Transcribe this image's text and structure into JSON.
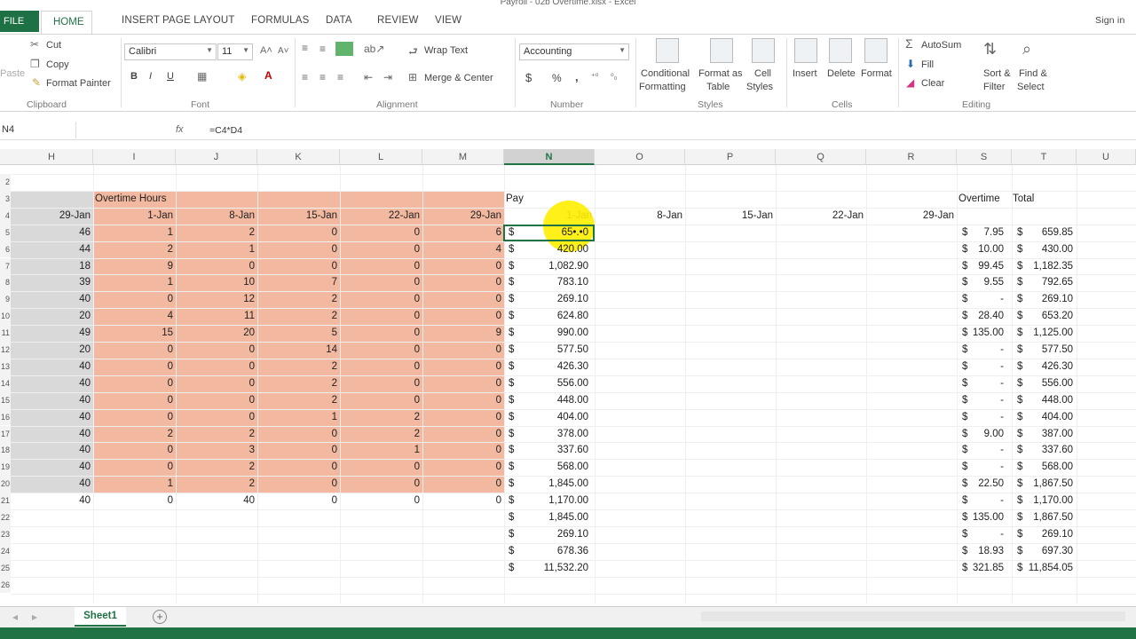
{
  "window": {
    "title": "Payroll - 02b Overtime.xlsx - Excel",
    "sign_in": "Sign in"
  },
  "tabs": {
    "file": "FILE",
    "home": "HOME",
    "insert": "INSERT",
    "page_layout": "PAGE LAYOUT",
    "formulas": "FORMULAS",
    "data": "DATA",
    "review": "REVIEW",
    "view": "VIEW"
  },
  "ribbon": {
    "clipboard": {
      "cut": "Cut",
      "copy": "Copy",
      "format_painter": "Format Painter",
      "paste": "Paste",
      "group": "Clipboard"
    },
    "font": {
      "name": "Calibri",
      "size": "11",
      "bold": "B",
      "italic": "I",
      "underline": "U",
      "group": "Font"
    },
    "alignment": {
      "wrap": "Wrap Text",
      "merge": "Merge & Center",
      "group": "Alignment"
    },
    "number": {
      "format": "Accounting",
      "currency": "$",
      "percent": "%",
      "comma": ",",
      "group": "Number"
    },
    "styles": {
      "conditional": "Conditional",
      "conditional2": "Formatting",
      "format_as": "Format as",
      "format_as2": "Table",
      "cell": "Cell",
      "cell2": "Styles",
      "group": "Styles"
    },
    "cells": {
      "insert": "Insert",
      "delete": "Delete",
      "format": "Format",
      "group": "Cells"
    },
    "editing": {
      "autosum": "AutoSum",
      "fill": "Fill",
      "clear": "Clear",
      "sort": "Sort &",
      "sort2": "Filter",
      "find": "Find &",
      "find2": "Select",
      "group": "Editing"
    }
  },
  "formula_bar": {
    "name_box": "N4",
    "fx": "fx",
    "formula": "=C4*D4"
  },
  "columns": [
    "H",
    "I",
    "J",
    "K",
    "L",
    "M",
    "N",
    "O",
    "P",
    "Q",
    "R",
    "S",
    "T",
    "U"
  ],
  "sheet": {
    "overtime_title": "Overtime Hours",
    "pay_title": "Pay",
    "overtime_label": "Overtime",
    "total_label": "Total",
    "date_headers": [
      "29-Jan",
      "1-Jan",
      "8-Jan",
      "15-Jan",
      "22-Jan",
      "29-Jan"
    ],
    "pay_headers": [
      "1-Jan",
      "8-Jan",
      "15-Jan",
      "22-Jan",
      "29-Jan"
    ],
    "row_numbers": [
      "2",
      "3",
      "4",
      "5",
      "6",
      "7",
      "8",
      "9",
      "10",
      "11",
      "12",
      "13",
      "14",
      "15",
      "16",
      "17",
      "18",
      "19",
      "20",
      "21",
      "22",
      "23",
      "24",
      "25",
      "26"
    ],
    "hours": [
      [
        "46",
        "1",
        "2",
        "0",
        "0",
        "6"
      ],
      [
        "44",
        "2",
        "1",
        "0",
        "0",
        "4"
      ],
      [
        "18",
        "9",
        "0",
        "0",
        "0",
        "0"
      ],
      [
        "39",
        "1",
        "10",
        "7",
        "0",
        "0"
      ],
      [
        "40",
        "0",
        "12",
        "2",
        "0",
        "0"
      ],
      [
        "20",
        "4",
        "11",
        "2",
        "0",
        "0"
      ],
      [
        "49",
        "15",
        "20",
        "5",
        "0",
        "9"
      ],
      [
        "20",
        "0",
        "0",
        "14",
        "0",
        "0"
      ],
      [
        "40",
        "0",
        "0",
        "2",
        "0",
        "0"
      ],
      [
        "40",
        "0",
        "0",
        "2",
        "0",
        "0"
      ],
      [
        "40",
        "0",
        "0",
        "2",
        "0",
        "0"
      ],
      [
        "40",
        "0",
        "0",
        "1",
        "2",
        "0"
      ],
      [
        "40",
        "2",
        "2",
        "0",
        "2",
        "0"
      ],
      [
        "40",
        "0",
        "3",
        "0",
        "1",
        "0"
      ],
      [
        "40",
        "0",
        "2",
        "0",
        "0",
        "0"
      ],
      [
        "40",
        "1",
        "2",
        "0",
        "0",
        "0"
      ],
      [
        "40",
        "0",
        "40",
        "0",
        "0",
        "0"
      ]
    ],
    "pay": [
      "659.85",
      "420.00",
      "1,082.90",
      "783.10",
      "269.10",
      "624.80",
      "990.00",
      "577.50",
      "426.30",
      "556.00",
      "448.00",
      "404.00",
      "378.00",
      "337.60",
      "568.00",
      "1,845.00",
      "1,170.00"
    ],
    "pay_selected_display": "65•.•0",
    "overtime": [
      "7.95",
      "10.00",
      "99.45",
      "9.55",
      "-",
      "28.40",
      "135.00",
      "-",
      "-",
      "-",
      "-",
      "-",
      "9.00",
      "-",
      "-",
      "22.50",
      "-"
    ],
    "total": [
      "659.85",
      "430.00",
      "1,182.35",
      "792.65",
      "269.10",
      "653.20",
      "1,125.00",
      "577.50",
      "426.30",
      "556.00",
      "448.00",
      "404.00",
      "387.00",
      "337.60",
      "568.00",
      "1,867.50",
      "1,170.00"
    ],
    "summary_pay": [
      "1,845.00",
      "269.10",
      "678.36",
      "11,532.20"
    ],
    "summary_overtime": [
      "135.00",
      "-",
      "18.93",
      "321.85"
    ],
    "summary_total": [
      "1,867.50",
      "269.10",
      "697.30",
      "11,854.05"
    ],
    "currency": "$"
  },
  "sheet_tabs": {
    "active": "Sheet1",
    "add": "+"
  },
  "colors": {
    "excel_green": "#217346",
    "shade_orange": "#f2b8a0",
    "shade_grey": "#d9d9d9",
    "highlight": "#ffee00"
  }
}
